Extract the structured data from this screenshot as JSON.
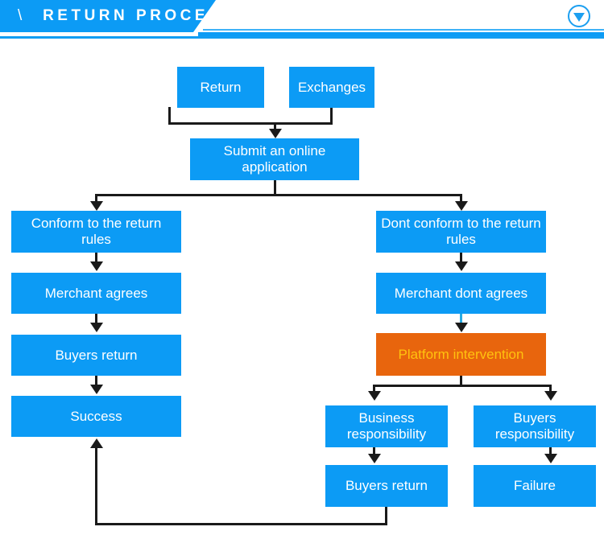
{
  "header": {
    "slash": "\\",
    "title": "RETURN PROCESS",
    "badge_icon": "circle-triangle-down-icon",
    "accent_color": "#0c9bf5"
  },
  "diagram": {
    "node_color": "#0c9bf5",
    "node_text_color": "#ffffff",
    "highlight_color": "#e8650d",
    "highlight_text_color": "#ffc20e",
    "connector_color": "#1a1a1a",
    "blue_connector_color": "#29abe2",
    "nodes": [
      {
        "id": "return",
        "label": "Return"
      },
      {
        "id": "exchanges",
        "label": "Exchanges"
      },
      {
        "id": "submit",
        "label": "Submit an online application"
      },
      {
        "id": "conform",
        "label": "Conform to the return rules"
      },
      {
        "id": "merchant-agrees",
        "label": "Merchant agrees"
      },
      {
        "id": "buyers-return-left",
        "label": "Buyers return"
      },
      {
        "id": "success",
        "label": "Success"
      },
      {
        "id": "dont-conform",
        "label": "Dont conform to the return rules"
      },
      {
        "id": "merchant-dont-agrees",
        "label": "Merchant dont agrees"
      },
      {
        "id": "platform-intervention",
        "label": "Platform intervention"
      },
      {
        "id": "business-responsibility",
        "label": "Business responsibility"
      },
      {
        "id": "buyers-responsibility",
        "label": "Buyers responsibility"
      },
      {
        "id": "buyers-return-right",
        "label": "Buyers return"
      },
      {
        "id": "failure",
        "label": "Failure"
      }
    ]
  }
}
